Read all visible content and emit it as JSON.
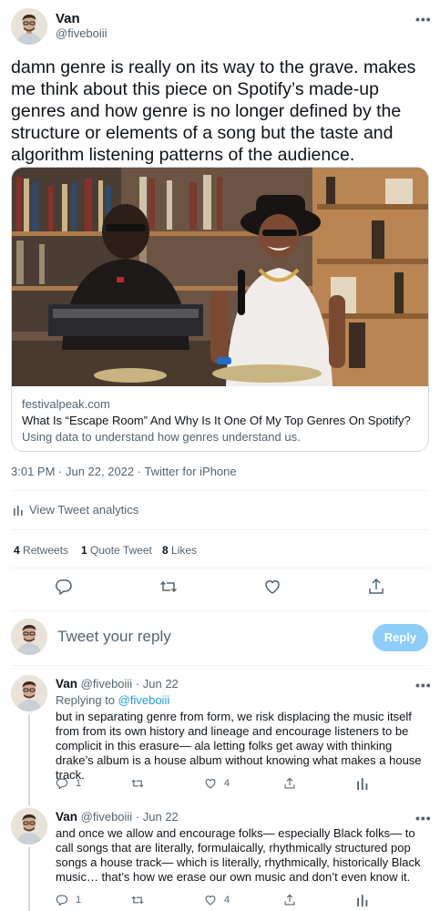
{
  "tweet": {
    "author_name": "Van",
    "author_handle": "@fiveboiii",
    "more_icon": "more-dots-icon",
    "text": "damn genre is really on its way to the grave. makes me think about this piece on Spotify’s made-up genres and how genre is no longer defined by the structure or elements of a song but the taste and algorithm listening patterns of the audience.",
    "timestamp": "3:01 PM · Jun 22, 2022 · Twitter for iPhone"
  },
  "link_card": {
    "domain": "festivalpeak.com",
    "title": "What Is “Escape Room” And Why Is It One Of My Top Genres On Spotify?",
    "description": "Using data to understand how genres understand us."
  },
  "analytics": {
    "label": "View Tweet analytics",
    "icon": "analytics-bars-icon"
  },
  "stats": {
    "retweets_count": "4",
    "retweets_label": "Retweets",
    "quotes_count": "1",
    "quotes_label": "Quote Tweet",
    "likes_count": "8",
    "likes_label": "Likes"
  },
  "actions": [
    "reply-icon",
    "retweet-icon",
    "like-icon",
    "share-icon"
  ],
  "compose": {
    "placeholder": "Tweet your reply",
    "button_label": "Reply"
  },
  "replies": [
    {
      "author_name": "Van",
      "handle_date": "@fiveboiii · Jun 22",
      "replying_prefix": "Replying to",
      "replying_to": "@fiveboiii",
      "text": "but in separating genre from form, we risk displacing the music itself from from its own history and lineage and encourage listeners to be complicit in this erasure— ala letting folks get away with thinking drake’s album is a house album without knowing what makes a house track.",
      "reply_count": "1",
      "like_count": "4"
    },
    {
      "author_name": "Van",
      "handle_date": "@fiveboiii · Jun 22",
      "text": "and once we allow and encourage folks— especially Black folks— to call songs that are literally, formulaically, rhythmically structured pop songs a house track— which is literally, rhythmically, historically Black music… that’s how we erase our own music and don’t even know it.",
      "reply_count": "1",
      "like_count": "4"
    }
  ],
  "colors": {
    "text_primary": "#0f1419",
    "text_secondary": "#536471",
    "accent": "#1d9bf0",
    "reply_button_disabled": "#8ecdf8",
    "divider": "#eff3f4"
  }
}
